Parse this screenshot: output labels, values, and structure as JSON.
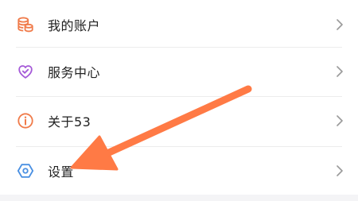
{
  "menu": {
    "items": [
      {
        "label": "我的账户",
        "icon": "wallet-coins-icon",
        "icon_color": "#f07b4a"
      },
      {
        "label": "服务中心",
        "icon": "heart-check-icon",
        "icon_color": "#a55ad8"
      },
      {
        "label": "关于53",
        "icon": "info-circle-icon",
        "icon_color": "#f07b4a"
      },
      {
        "label": "设置",
        "icon": "hexagon-gear-icon",
        "icon_color": "#4a90e2"
      }
    ],
    "chevron_icon": "chevron-right-icon"
  },
  "annotation": {
    "icon": "orange-arrow-icon",
    "color": "#ff7a45",
    "points_to": "设置"
  }
}
